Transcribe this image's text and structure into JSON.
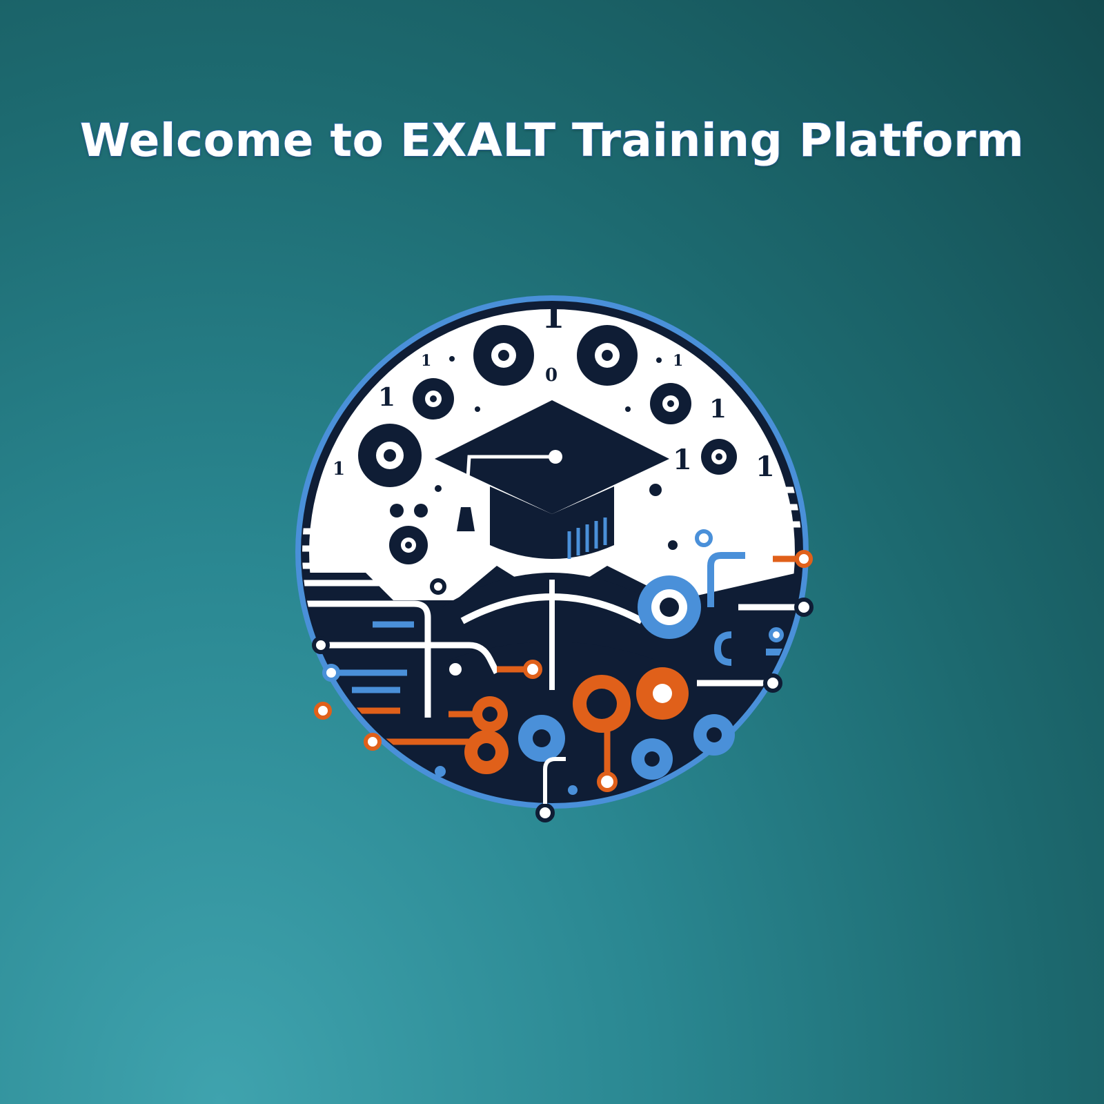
{
  "header": {
    "title": "Welcome to EXALT Training Platform"
  },
  "logo": {
    "icon": "graduation-cap-circuit-logo",
    "binary_digits": [
      "1",
      "1",
      "0",
      "1",
      "1",
      "1",
      "1",
      "1",
      "1"
    ]
  },
  "colors": {
    "background": "#1d6a70",
    "navy": "#0f1d35",
    "blue": "#4a90d9",
    "orange": "#e0601a",
    "white": "#ffffff"
  }
}
